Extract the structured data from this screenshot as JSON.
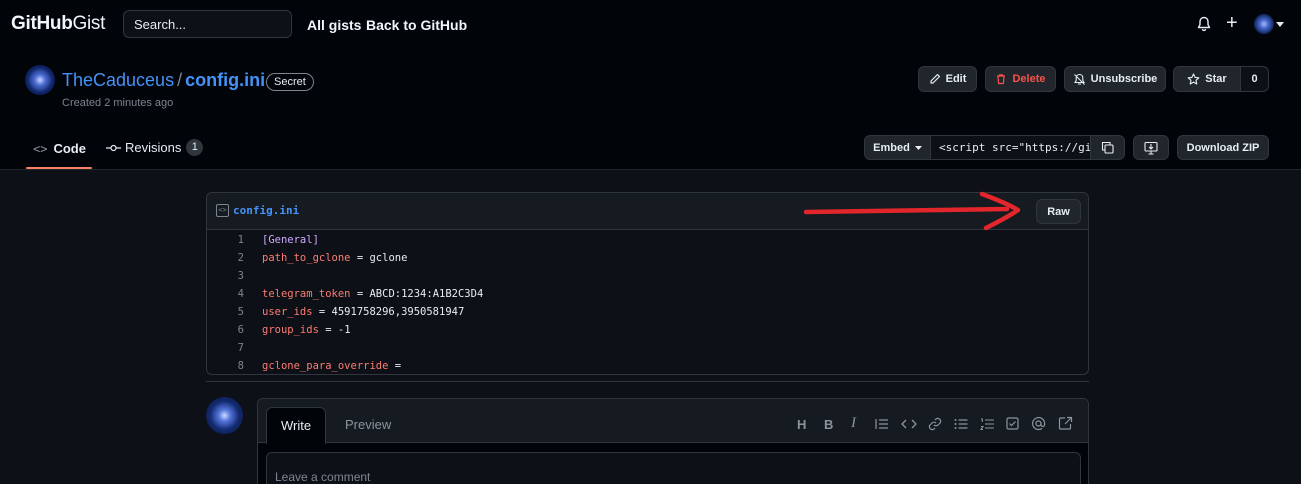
{
  "topbar": {
    "logo_bold": "GitHub",
    "logo_light": "Gist",
    "search_placeholder": "Search...",
    "all_gists": "All gists",
    "back_to_github": "Back to GitHub",
    "plus": "+"
  },
  "gist": {
    "owner": "TheCaduceus",
    "separator": "/",
    "filename": "config.ini",
    "visibility": "Secret",
    "created": "Created 2 minutes ago"
  },
  "actions": {
    "edit": "Edit",
    "delete": "Delete",
    "unsubscribe": "Unsubscribe",
    "star": "Star",
    "star_count": "0"
  },
  "tabs": {
    "code": "Code",
    "revisions": "Revisions",
    "revisions_count": "1"
  },
  "embed": {
    "label": "Embed",
    "value": "<script src=\"https://gist.github.com/",
    "download_zip": "Download ZIP"
  },
  "file": {
    "name": "config.ini",
    "raw": "Raw",
    "lines": [
      {
        "n": "1",
        "key": "",
        "rest": "[General]"
      },
      {
        "n": "2",
        "key": "path_to_gclone",
        "rest": " = gclone"
      },
      {
        "n": "3",
        "key": "",
        "rest": ""
      },
      {
        "n": "4",
        "key": "telegram_token",
        "rest": " = ABCD:1234:A1B2C3D4"
      },
      {
        "n": "5",
        "key": "user_ids",
        "rest": " = 4591758296,3950581947"
      },
      {
        "n": "6",
        "key": "group_ids",
        "rest": " = -1"
      },
      {
        "n": "7",
        "key": "",
        "rest": ""
      },
      {
        "n": "8",
        "key": "gclone_para_override",
        "rest": " ="
      }
    ]
  },
  "comment": {
    "write": "Write",
    "preview": "Preview",
    "placeholder": "Leave a comment",
    "toolbar": [
      "H",
      "B",
      "I"
    ]
  },
  "annotation_color": "#e3262b"
}
